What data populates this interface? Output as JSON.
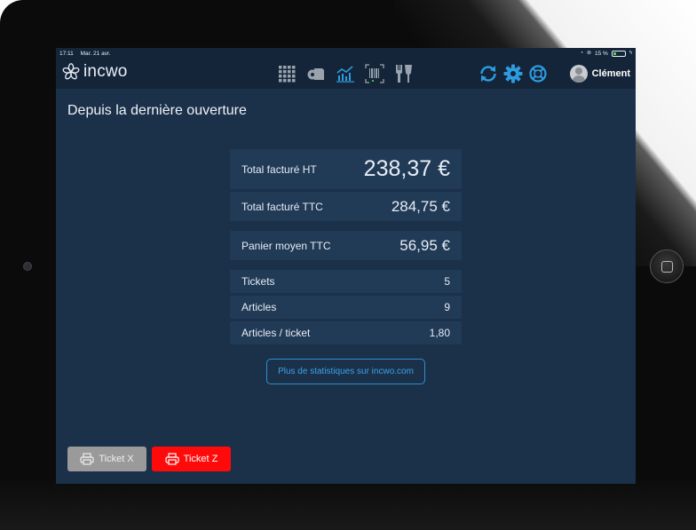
{
  "status_bar": {
    "time": "17:11",
    "date": "Mar. 21 avr.",
    "battery": "15 %"
  },
  "app": {
    "logo_text": "incwo"
  },
  "nav": {
    "icons": [
      "grid-icon",
      "tag-icon",
      "stats-icon",
      "barcode-icon",
      "restaurant-icon"
    ],
    "active": "stats-icon",
    "right_icons": [
      "sync-icon",
      "settings-icon",
      "help-icon"
    ]
  },
  "user": {
    "name": "Clément"
  },
  "page": {
    "title": "Depuis la dernière ouverture"
  },
  "stats": {
    "total_ht": {
      "label": "Total facturé HT",
      "value": "238,37 €"
    },
    "total_ttc": {
      "label": "Total facturé TTC",
      "value": "284,75 €"
    },
    "panier": {
      "label": "Panier moyen TTC",
      "value": "56,95 €"
    },
    "tickets": {
      "label": "Tickets",
      "value": "5"
    },
    "articles": {
      "label": "Articles",
      "value": "9"
    },
    "articles_per_ticket": {
      "label": "Articles / ticket",
      "value": "1,80"
    }
  },
  "more_stats_label": "Plus de statistiques sur incwo.com",
  "ticket_x_label": "Ticket X",
  "ticket_z_label": "Ticket Z",
  "colors": {
    "accent": "#2e9be0",
    "danger": "#ff0a0a",
    "background": "#1b3049"
  }
}
